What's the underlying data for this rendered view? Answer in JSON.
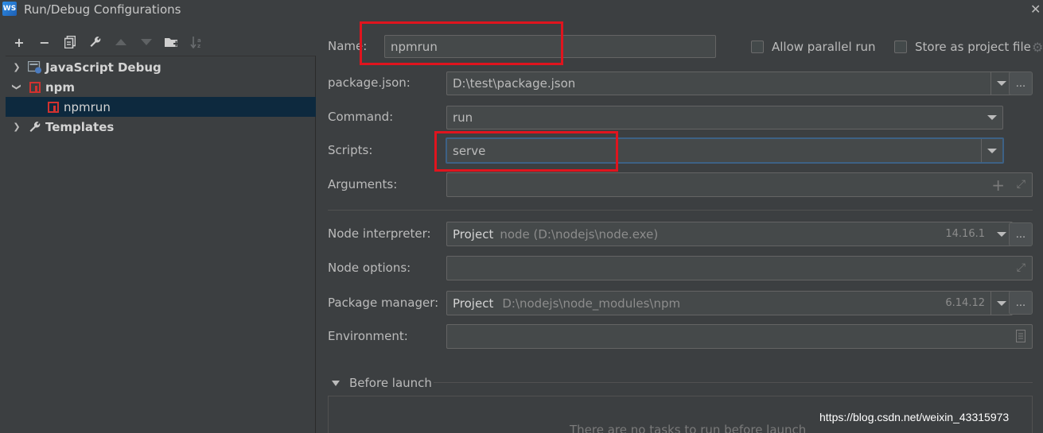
{
  "window": {
    "title": "Run/Debug Configurations",
    "app_icon": "WS"
  },
  "toolbar": {
    "buttons": [
      {
        "icon": "plus-icon",
        "glyph": "+"
      },
      {
        "icon": "minus-icon",
        "glyph": "−"
      },
      {
        "icon": "copy-icon"
      },
      {
        "icon": "wrench-icon"
      },
      {
        "icon": "move-up-icon"
      },
      {
        "icon": "move-down-icon"
      },
      {
        "icon": "new-folder-icon"
      },
      {
        "icon": "sort-icon"
      }
    ]
  },
  "tree": {
    "items": [
      {
        "label": "JavaScript Debug",
        "icon": "javascript-debug-icon"
      },
      {
        "label": "npm",
        "icon": "npm-icon"
      },
      {
        "label": "npmrun",
        "icon": "npm-icon"
      },
      {
        "label": "Templates",
        "icon": "wrench-icon"
      }
    ]
  },
  "form": {
    "name_label": "Name:",
    "name_value": "npmrun",
    "allow_parallel_label": "Allow parallel run",
    "store_project_label": "Store as project file",
    "package_json_label": "package.json:",
    "package_json_value": "D:\\test\\package.json",
    "command_label": "Command:",
    "command_value": "run",
    "scripts_label": "Scripts:",
    "scripts_value": "serve",
    "arguments_label": "Arguments:",
    "node_interpreter_label": "Node interpreter:",
    "node_interpreter_prefix": "Project",
    "node_interpreter_path": "node (D:\\nodejs\\node.exe)",
    "node_interpreter_version": "14.16.1",
    "node_options_label": "Node options:",
    "package_manager_label": "Package manager:",
    "package_manager_prefix": "Project",
    "package_manager_path": "D:\\nodejs\\node_modules\\npm",
    "package_manager_version": "6.14.12",
    "environment_label": "Environment:",
    "before_launch_label": "Before launch",
    "before_launch_empty": "There are no tasks to run before launch",
    "browse_label": "..."
  },
  "watermark": "https://blog.csdn.net/weixin_43315973",
  "colors": {
    "highlight_box": "#e0141e",
    "selection": "#0d293e",
    "background": "#3c3f41"
  }
}
